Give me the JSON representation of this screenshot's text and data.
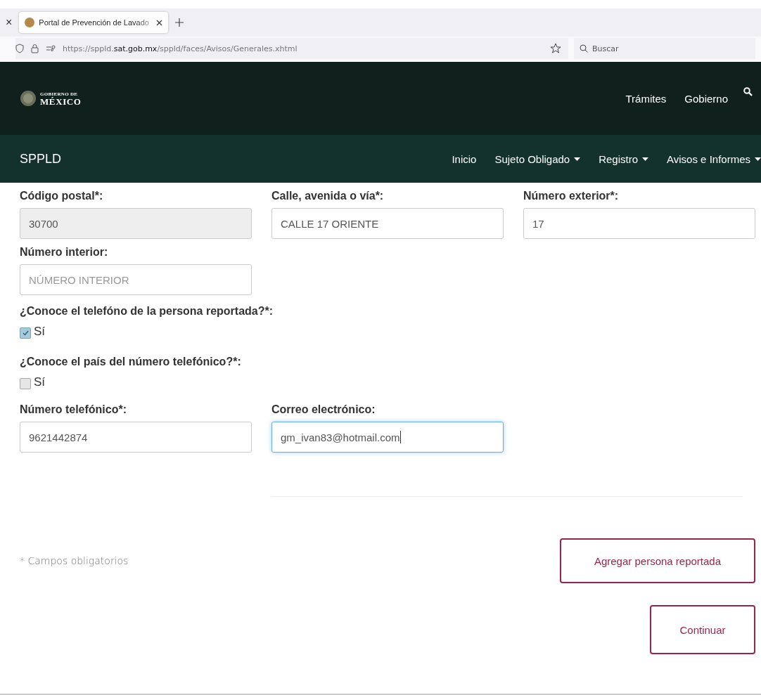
{
  "browser": {
    "prev_tab_close": "×",
    "tab_title": "Portal de Prevención de Lavado",
    "url": "https://sppld.**sat.gob.mx**/sppld/faces/Avisos/Generales.xhtml",
    "search": {
      "placeholder": "Buscar"
    }
  },
  "gov_header": {
    "logo_top": "GOBIERNO DE",
    "logo_bottom": "MÉXICO",
    "links": [
      "Trámites",
      "Gobierno"
    ]
  },
  "nav": {
    "brand": "SPPLD",
    "items": [
      {
        "label": "Inicio",
        "dropdown": false
      },
      {
        "label": "Sujeto Obligado",
        "dropdown": true
      },
      {
        "label": "Registro",
        "dropdown": true
      },
      {
        "label": "Avisos e Informes",
        "dropdown": true
      }
    ]
  },
  "form": {
    "rows": [
      {
        "kind": "fields",
        "fields": [
          {
            "label": "Código postal*:",
            "value": "30700",
            "disabled": true,
            "focused": false
          },
          {
            "label": "Calle, avenida o vía*:",
            "value": "CALLE 17 ORIENTE",
            "disabled": false,
            "focused": false
          },
          {
            "label": "Número exterior*:",
            "value": "17",
            "disabled": false,
            "focused": false
          }
        ]
      },
      {
        "kind": "fields",
        "fields": [
          {
            "label": "Número interior:",
            "placeholder": "NÚMERO INTERIOR",
            "disabled": false,
            "focused": false
          }
        ]
      },
      {
        "kind": "checkbox",
        "question": "¿Conoce el telefóno de la persona reportada?*:",
        "option": "Sí",
        "checked": true
      },
      {
        "kind": "checkbox",
        "question": "¿Conoce el país del número telefónico?*:",
        "option": "Sí",
        "checked": false
      },
      {
        "kind": "fields",
        "fields": [
          {
            "label": "Número telefónico*:",
            "value": "9621442874",
            "disabled": false,
            "focused": false
          },
          {
            "label": "Correo electrónico:",
            "value": "gm_ivan83@hotmail.com",
            "disabled": false,
            "focused": true
          }
        ]
      }
    ],
    "required_note": "* Campos obligatorios",
    "buttons": [
      "Agregar persona reportada",
      "Continuar"
    ]
  }
}
